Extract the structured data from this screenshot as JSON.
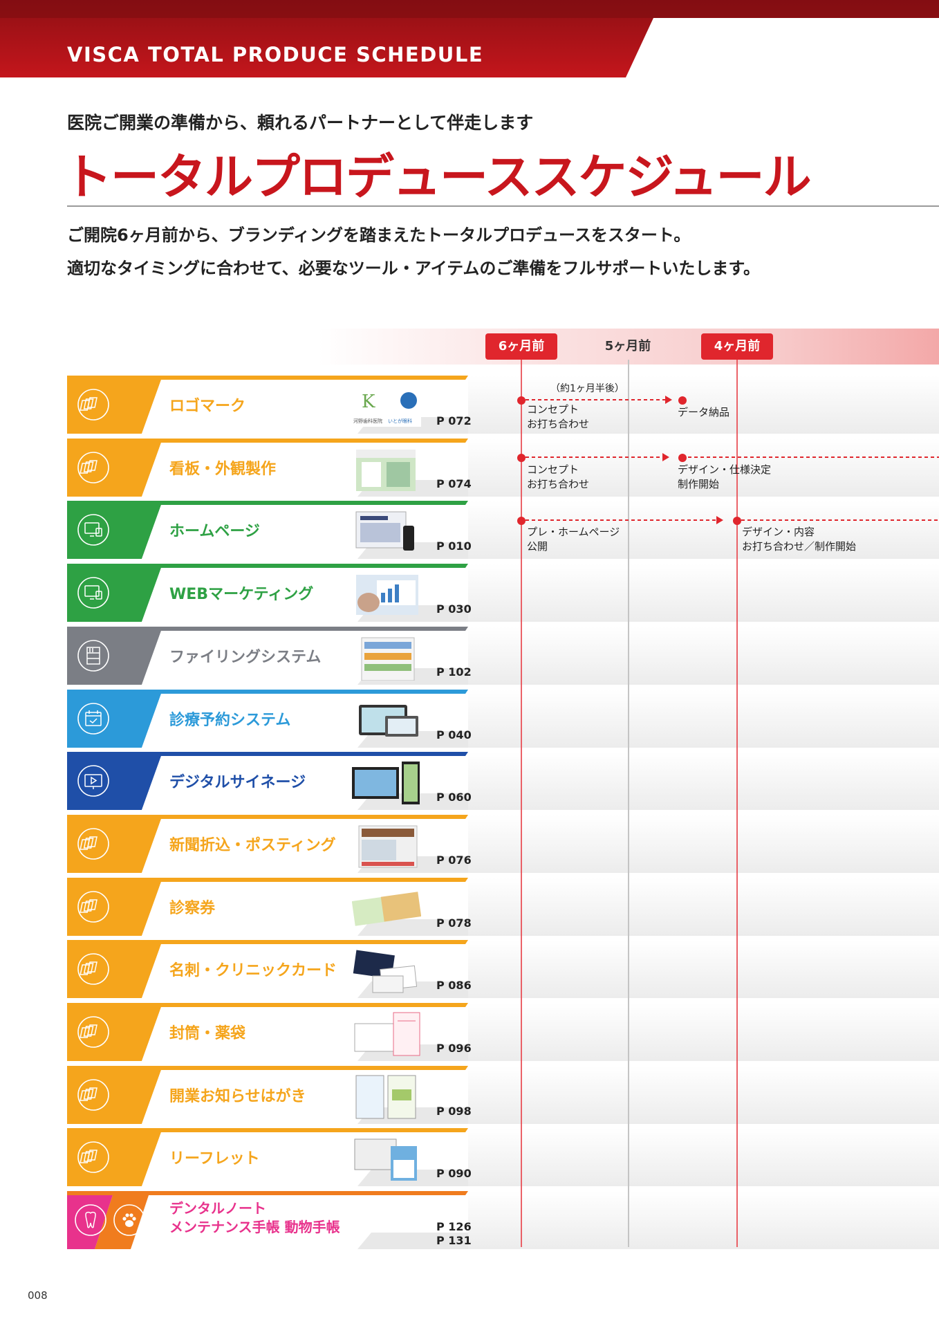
{
  "header": {
    "title": "VISCA TOTAL PRODUCE SCHEDULE"
  },
  "subtitle": "医院ご開業の準備から、頼れるパートナーとして伴走します",
  "main_title": "トータルプロデューススケジュール",
  "intro": [
    "ご開院6ヶ月前から、ブランディングを踏まえたトータルプロデュースをスタート。",
    "適切なタイミングに合わせて、必要なツール・アイテムのご準備をフルサポートいたします。"
  ],
  "months": [
    "6ヶ月前",
    "5ヶ月前",
    "4ヶ月前"
  ],
  "rows": [
    {
      "label": "ロゴマーク",
      "page": "P 072",
      "color": "#f5a51c",
      "icon": "layers-icon"
    },
    {
      "label": "看板・外観製作",
      "page": "P 074",
      "color": "#f5a51c",
      "icon": "layers-icon"
    },
    {
      "label": "ホームページ",
      "page": "P 010",
      "color": "#2ea144",
      "icon": "monitor-icon"
    },
    {
      "label": "WEBマーケティング",
      "page": "P 030",
      "color": "#2ea144",
      "icon": "monitor-icon"
    },
    {
      "label": "ファイリングシステム",
      "page": "P 102",
      "color": "#7b7e85",
      "icon": "shelf-icon"
    },
    {
      "label": "診療予約システム",
      "page": "P 040",
      "color": "#2c9ad9",
      "icon": "calendar-icon"
    },
    {
      "label": "デジタルサイネージ",
      "page": "P 060",
      "color": "#1f4fa8",
      "icon": "play-screen-icon"
    },
    {
      "label": "新聞折込・ポスティング",
      "page": "P 076",
      "color": "#f5a51c",
      "icon": "layers-icon"
    },
    {
      "label": "診察券",
      "page": "P 078",
      "color": "#f5a51c",
      "icon": "layers-icon"
    },
    {
      "label": "名刺・クリニックカード",
      "page": "P 086",
      "color": "#f5a51c",
      "icon": "layers-icon"
    },
    {
      "label": "封筒・薬袋",
      "page": "P 096",
      "color": "#f5a51c",
      "icon": "layers-icon"
    },
    {
      "label": "開業お知らせはがき",
      "page": "P 098",
      "color": "#f5a51c",
      "icon": "layers-icon"
    },
    {
      "label": "リーフレット",
      "page": "P 090",
      "color": "#f5a51c",
      "icon": "layers-icon"
    }
  ],
  "last_row": {
    "label1": "デンタルノート",
    "label2": "メンテナンス手帳 動物手帳",
    "page1": "P 126",
    "page2": "P 131",
    "color1": "#e8328c",
    "color2": "#f07c1e",
    "icon1": "tooth-icon",
    "icon2": "paw-icon"
  },
  "thumbs": {
    "logo_a": "K",
    "logo_a_caption": "河野歯科医院",
    "logo_b_caption": "いとが眼科"
  },
  "notes": {
    "logo_delay": "（約1ヶ月半後）",
    "logo_start": [
      "コンセプト",
      "お打ち合わせ"
    ],
    "logo_end": "データ納品",
    "sign_start": [
      "コンセプト",
      "お打ち合わせ"
    ],
    "sign_end": [
      "デザイン・仕様決定",
      "制作開始"
    ],
    "hp_start": [
      "プレ・ホームページ",
      "公開"
    ],
    "hp_end": [
      "デザイン・内容",
      "お打ち合わせ／制作開始"
    ]
  },
  "page_number": "008"
}
